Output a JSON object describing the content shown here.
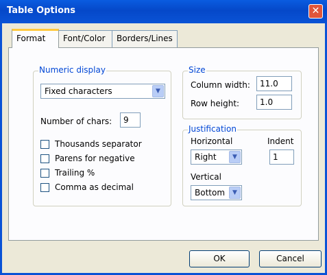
{
  "window": {
    "title": "Table Options",
    "close_glyph": "✕"
  },
  "tabs": [
    {
      "label": "Format",
      "active": true
    },
    {
      "label": "Font/Color",
      "active": false
    },
    {
      "label": "Borders/Lines",
      "active": false
    }
  ],
  "numeric_display": {
    "group_label": "Numeric display",
    "format_select_value": "Fixed characters",
    "num_chars_label": "Number of chars:",
    "num_chars_value": "9",
    "checkboxes": [
      {
        "label": "Thousands separator",
        "checked": false
      },
      {
        "label": "Parens for negative",
        "checked": false
      },
      {
        "label": "Trailing %",
        "checked": false
      },
      {
        "label": "Comma as decimal",
        "checked": false
      }
    ]
  },
  "size": {
    "group_label": "Size",
    "column_width_label": "Column width:",
    "column_width_value": "11.0",
    "row_height_label": "Row height:",
    "row_height_value": "1.0"
  },
  "justification": {
    "group_label": "Justification",
    "horizontal_label": "Horizontal",
    "horizontal_value": "Right",
    "indent_label": "Indent",
    "indent_value": "1",
    "vertical_label": "Vertical",
    "vertical_value": "Bottom"
  },
  "buttons": {
    "ok": "OK",
    "cancel": "Cancel"
  },
  "colors": {
    "titlebar": "#0548c9",
    "group_label": "#0046d5",
    "tab_highlight": "#ffc83c"
  }
}
